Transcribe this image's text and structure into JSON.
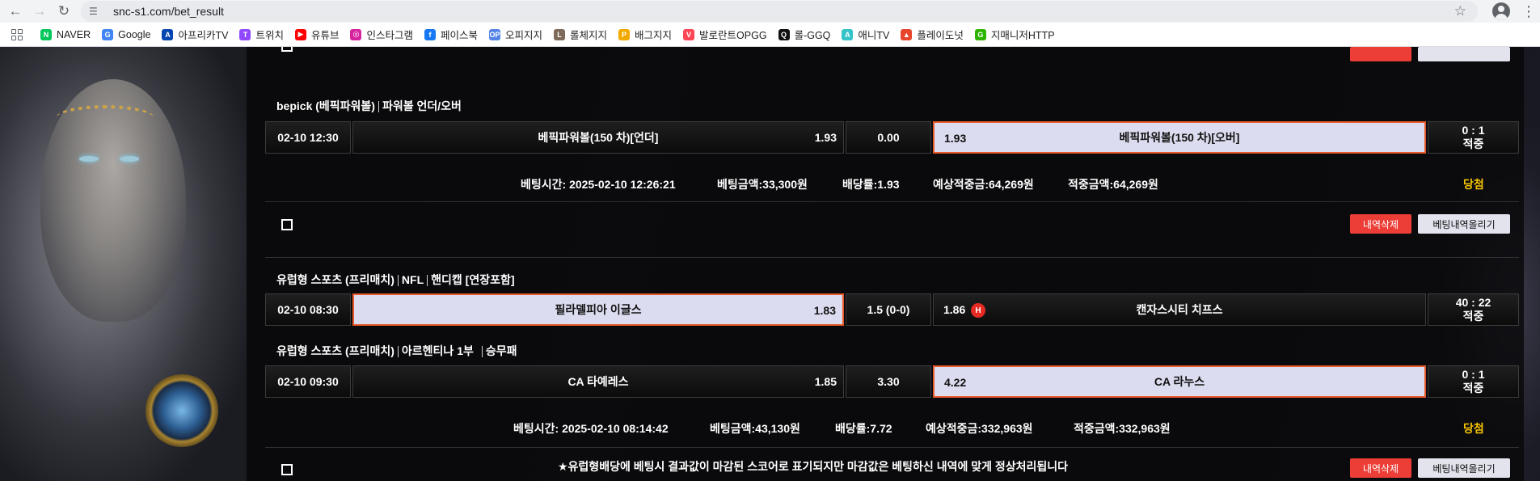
{
  "browser": {
    "url": "snc-s1.com/bet_result",
    "bookmarks": [
      {
        "label": "NAVER",
        "icon": "naver-icon",
        "color": "#03c75a",
        "glyph": "N"
      },
      {
        "label": "Google",
        "icon": "google-icon",
        "color": "#4285f4",
        "glyph": "G"
      },
      {
        "label": "아프리카TV",
        "icon": "afreecatv-icon",
        "color": "#0545b1",
        "glyph": "A"
      },
      {
        "label": "트위치",
        "icon": "twitch-icon",
        "color": "#9146ff",
        "glyph": "T"
      },
      {
        "label": "유튜브",
        "icon": "youtube-icon",
        "color": "#ff0000",
        "glyph": "▶"
      },
      {
        "label": "인스타그램",
        "icon": "instagram-icon",
        "color": "#d6249f",
        "glyph": "◎"
      },
      {
        "label": "페이스북",
        "icon": "facebook-icon",
        "color": "#1877f2",
        "glyph": "f"
      },
      {
        "label": "오피지지",
        "icon": "opgg-icon",
        "color": "#5383e8",
        "glyph": "OP"
      },
      {
        "label": "롤체지지",
        "icon": "lolchess-icon",
        "color": "#7d6a5a",
        "glyph": "L"
      },
      {
        "label": "배그지지",
        "icon": "pubg-icon",
        "color": "#f2a900",
        "glyph": "P"
      },
      {
        "label": "발로란트OPGG",
        "icon": "valorant-opgg-icon",
        "color": "#ff4655",
        "glyph": "V"
      },
      {
        "label": "롤-GGQ",
        "icon": "ggq-icon",
        "color": "#111111",
        "glyph": "Q"
      },
      {
        "label": "애니TV",
        "icon": "anitv-icon",
        "color": "#34c3c8",
        "glyph": "A"
      },
      {
        "label": "플레이도넛",
        "icon": "playdonut-icon",
        "color": "#e8462c",
        "glyph": "▲"
      },
      {
        "label": "지매니저HTTP",
        "icon": "gmanager-icon",
        "color": "#2db400",
        "glyph": "G"
      }
    ]
  },
  "bets": [
    {
      "titles": [
        "bepick (베픽파워볼)",
        "파워볼 언더/오버"
      ],
      "rows": [
        {
          "date": "02-10 12:30",
          "home": "베픽파워볼(150 차)[언더]",
          "home_odds": "1.93",
          "mid": "0.00",
          "away_odds": "1.93",
          "away": "베픽파워볼(150 차)[오버]",
          "score": "0 : 1",
          "result": "적중",
          "selected": "away"
        }
      ],
      "summary": {
        "time": "베팅시간: 2025-02-10 12:26:21",
        "amount": "베팅금액:33,300원",
        "odds": "배당률:1.93",
        "expected": "예상적중금:64,269원",
        "won": "적중금액:64,269원",
        "status": "당첨"
      }
    },
    {
      "titles_1": [
        "유럽형 스포츠 (프리매치)",
        "NFL",
        "핸디캡 [연장포함]"
      ],
      "row_1": {
        "date": "02-10 08:30",
        "home": "필라델피아 이글스",
        "home_odds": "1.83",
        "mid": "1.5 (0-0)",
        "away_odds": "1.86",
        "away_badge": "H",
        "away": "캔자스시티 치프스",
        "score": "40 : 22",
        "result": "적중",
        "selected": "home"
      },
      "titles_2": [
        "유럽형 스포츠 (프리매치)",
        "아르헨티나 1부",
        "승무패"
      ],
      "row_2": {
        "date": "02-10 09:30",
        "home": "CA 타예레스",
        "home_odds": "1.85",
        "mid": "3.30",
        "away_odds": "4.22",
        "away": "CA 라누스",
        "score": "0 : 1",
        "result": "적중",
        "selected": "away"
      },
      "summary": {
        "time": "베팅시간: 2025-02-10 08:14:42",
        "amount": "베팅금액:43,130원",
        "odds": "배당률:7.72",
        "expected": "예상적중금:332,963원",
        "won": "적중금액:332,963원",
        "status": "당첨"
      }
    }
  ],
  "actions": {
    "delete_label": "내역삭제",
    "upload_label": "베팅내역올리기"
  },
  "notice": "★유럽형배당에 베팅시 결과값이 마감된 스코어로 표기되지만 마감값은 베팅하신 내역에 맞게 정상처리됩니다",
  "colors": {
    "selected_bg": "#dcdcf0",
    "selected_border": "#e85a2a",
    "win": "#f4c300",
    "delete_btn": "#ec3e36"
  }
}
